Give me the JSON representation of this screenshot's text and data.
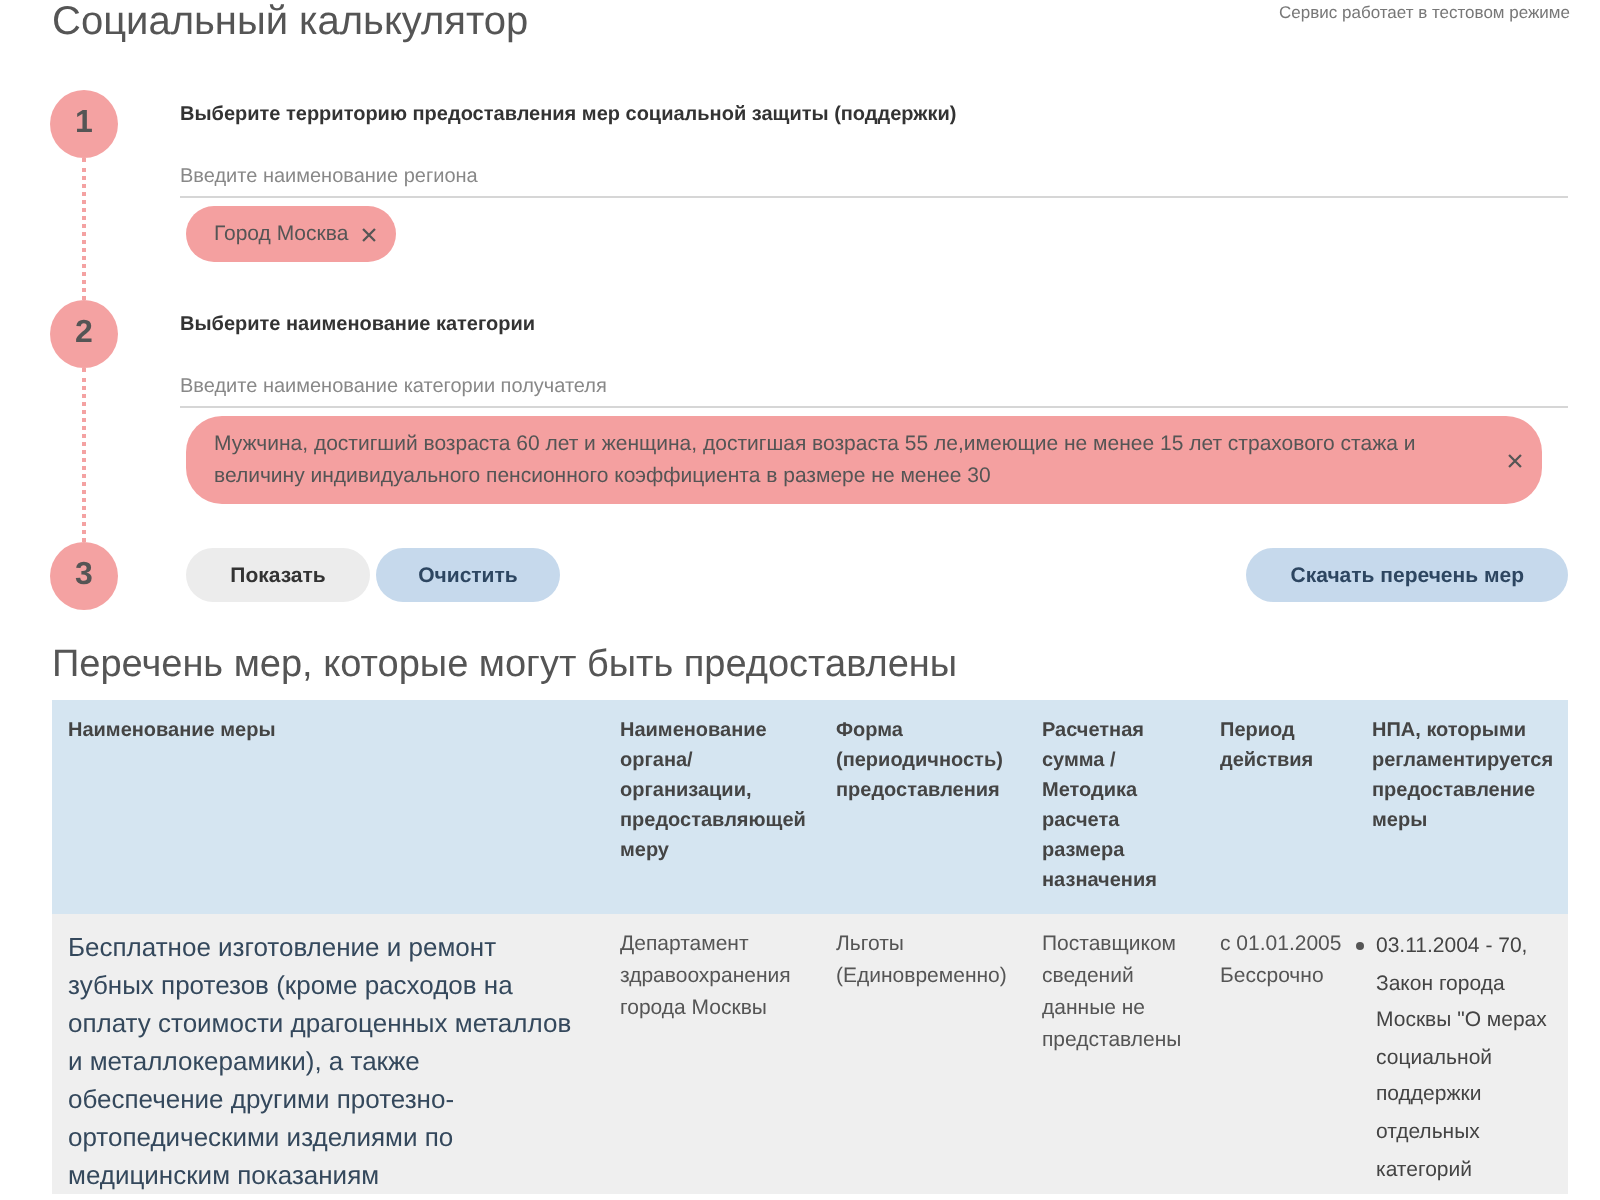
{
  "header": {
    "title": "Социальный калькулятор",
    "notice": "Сервис работает в тестовом режиме"
  },
  "steps": [
    {
      "number": "1",
      "kind": "select",
      "label": "Выберите территорию предоставления мер социальной защиты (поддержки)",
      "field": {
        "placeholder": "Введите наименование региона"
      },
      "chips": [
        {
          "text": "Город Москва"
        }
      ]
    },
    {
      "number": "2",
      "kind": "select",
      "label": "Выберите наименование категории",
      "field": {
        "placeholder": "Введите наименование категории получателя"
      },
      "chips": [
        {
          "text": "Мужчина, достигший возраста 60 лет и женщина, достигшая возраста 55 ле,имеющие не менее 15 лет страхового стажа и величину индивидуального пенсионного коэффициента в размере не менее 30"
        }
      ]
    },
    {
      "number": "3",
      "kind": "actions",
      "buttons": [
        {
          "label": "Показать",
          "kind": "neutral"
        },
        {
          "label": "Очистить",
          "kind": "accent"
        }
      ],
      "side_buttons": [
        {
          "label": "Скачать перечень мер",
          "kind": "accent"
        }
      ]
    }
  ],
  "measures": {
    "title": "Перечень мер, которые могут быть предоставлены",
    "table": {
      "columns": [
        "Наименование меры",
        "Наименование органа/ организации, предоставляющей меру",
        "Форма (периодичность) предоставления",
        "Расчетная сумма / Методика расчета размера назначения",
        "Период действия",
        "НПА, которыми регламентируется предоставление меры"
      ],
      "rows": [
        {
          "cells": [
            "Бесплатное изготовление и ремонт зубных протезов (кроме расходов на оплату стоимости драгоценных металлов и металлокерамики), а также обеспечение другими протезно-ортопедическими изделиями по медицинским показаниям",
            "Департамент здравоохранения города Москвы",
            "Льготы (Единовременно)",
            "Поставщиком сведений данные не представлены",
            "с 01.01.2005 Бессрочно"
          ],
          "acts": [
            "03.11.2004 - 70, Закон города Москвы \"О мерах социальной поддержки отдельных категорий"
          ]
        }
      ]
    }
  }
}
